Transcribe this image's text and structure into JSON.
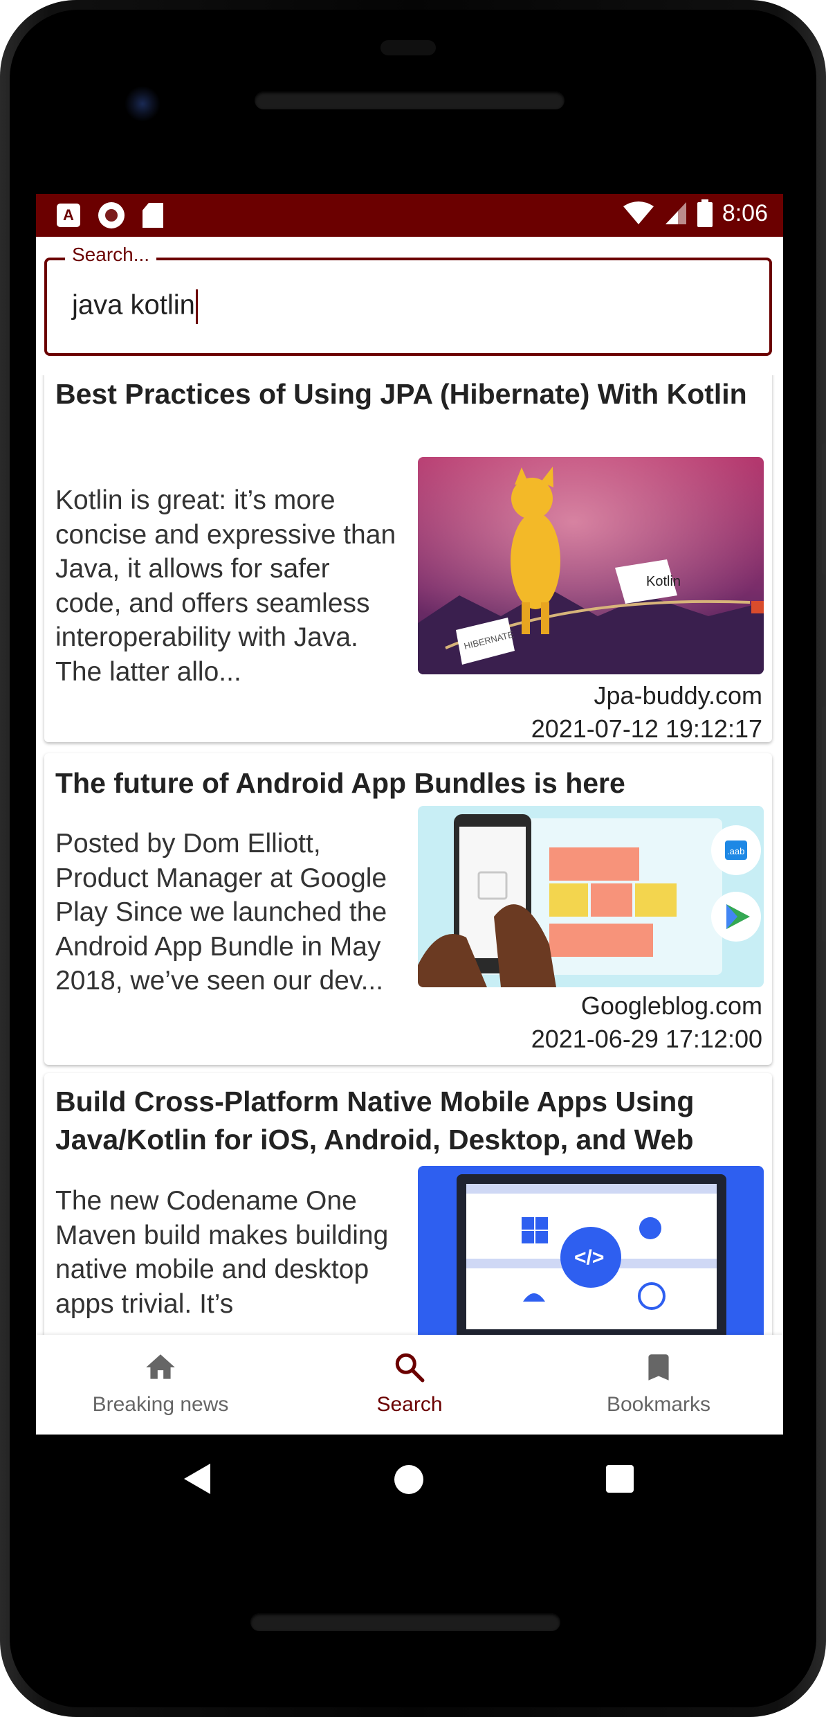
{
  "status_bar": {
    "time": "8:06",
    "accent": "#6b0000"
  },
  "search": {
    "label": "Search...",
    "value": "java kotlin"
  },
  "articles": [
    {
      "title": "Best Practices of Using JPA (Hibernate) With Kotlin",
      "description": "Kotlin is great: it’s more concise and expressive than Java, it allows for safer code, and offers seamless interoperability with Java. The latter allo...",
      "source": "Jpa-buddy.com",
      "date": "2021-07-12 19:12:17",
      "image_labels": {
        "flag_right": "Kotlin",
        "flag_left": "HIBERNATE"
      }
    },
    {
      "title": "The future of Android App Bundles is here",
      "description": "Posted by Dom Elliott, Product Manager at Google Play        Since we launched the Android App Bundle  in May 2018, we’ve seen our dev...",
      "source": "Googleblog.com",
      "date": "2021-06-29 17:12:00",
      "image_labels": {
        "badge": ".aab"
      }
    },
    {
      "title": "Build Cross-Platform Native Mobile Apps Using Java/Kotlin for iOS, Android, Desktop, and Web",
      "description": "The new Codename One Maven build makes building native mobile and desktop apps trivial.  It’s"
    }
  ],
  "bottom_nav": [
    {
      "label": "Breaking news",
      "icon": "home-icon",
      "active": false
    },
    {
      "label": "Search",
      "icon": "search-icon",
      "active": true
    },
    {
      "label": "Bookmarks",
      "icon": "bookmark-icon",
      "active": false
    }
  ]
}
